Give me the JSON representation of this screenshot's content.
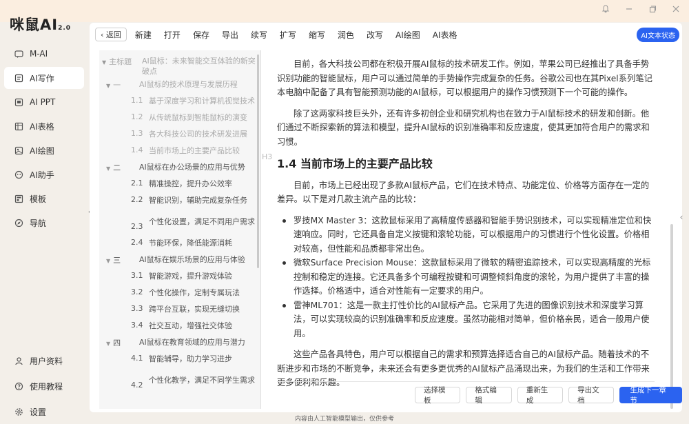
{
  "app": {
    "logo": "咪鼠AI",
    "version": "2.0"
  },
  "window_controls": [
    "bell-icon",
    "minimize-icon",
    "maximize-icon",
    "close-icon"
  ],
  "sidebar": {
    "items": [
      {
        "label": "M-AI",
        "icon": "chat-icon"
      },
      {
        "label": "AI写作",
        "icon": "write-icon",
        "active": true
      },
      {
        "label": "AI PPT",
        "icon": "ppt-icon"
      },
      {
        "label": "AI表格",
        "icon": "table-icon"
      },
      {
        "label": "AI绘图",
        "icon": "image-icon"
      },
      {
        "label": "AI助手",
        "icon": "assistant-icon"
      },
      {
        "label": "模板",
        "icon": "template-icon"
      },
      {
        "label": "导航",
        "icon": "compass-icon"
      }
    ],
    "bottom_items": [
      {
        "label": "用户资料",
        "icon": "user-icon"
      },
      {
        "label": "使用教程",
        "icon": "help-icon"
      },
      {
        "label": "设置",
        "icon": "gear-icon"
      }
    ]
  },
  "toolbar": {
    "back": "返回",
    "items": [
      "新建",
      "打开",
      "保存",
      "导出",
      "续写",
      "扩写",
      "缩写",
      "润色",
      "改写",
      "AI绘图",
      "AI表格"
    ],
    "status_badge": "AI文本状态"
  },
  "outline": {
    "root": {
      "num": "主标题",
      "text": "AI鼠标：未来智能交互体验的新突破点"
    },
    "sections": [
      {
        "num": "一",
        "text": "AI鼠标的技术原理与发展历程",
        "dim": true,
        "children": [
          {
            "num": "1.1",
            "text": "基于深度学习和计算机视觉技术"
          },
          {
            "num": "1.2",
            "text": "从传统鼠标到智能鼠标的演变"
          },
          {
            "num": "1.3",
            "text": "各大科技公司的技术研发进展"
          },
          {
            "num": "1.4",
            "text": "当前市场上的主要产品比较"
          }
        ]
      },
      {
        "num": "二",
        "text": "AI鼠标在办公场景的应用与优势",
        "children": [
          {
            "num": "2.1",
            "text": "精准操控，提升办公效率"
          },
          {
            "num": "2.2",
            "text": "智能识别，辅助完成复杂任务"
          },
          {
            "num": "2.3",
            "text": "个性化设置，满足不同用户需求"
          },
          {
            "num": "2.4",
            "text": "节能环保，降低能源消耗"
          }
        ]
      },
      {
        "num": "三",
        "text": "AI鼠标在娱乐场景的应用与体验",
        "children": [
          {
            "num": "3.1",
            "text": "智能游戏，提升游戏体验"
          },
          {
            "num": "3.2",
            "text": "个性化操作，定制专属玩法"
          },
          {
            "num": "3.3",
            "text": "跨平台互联，实现无缝切换"
          },
          {
            "num": "3.4",
            "text": "社交互动，增强社交体验"
          }
        ]
      },
      {
        "num": "四",
        "text": "AI鼠标在教育领域的应用与潜力",
        "children": [
          {
            "num": "4.1",
            "text": "智能辅导，助力学习进步"
          },
          {
            "num": "4.2",
            "text": "个性化教学，满足不同学生需求"
          }
        ]
      }
    ],
    "h3_tag": "H3"
  },
  "content": {
    "p1": "目前，各大科技公司都在积极开展AI鼠标的技术研发工作。例如，苹果公司已经推出了具备手势识别功能的智能鼠标，用户可以通过简单的手势操作完成复杂的任务。谷歌公司也在其Pixel系列笔记本电脑中配备了具有智能预测功能的AI鼠标，可以根据用户的操作习惯预测下一个可能的操作。",
    "p2": "除了这两家科技巨头外，还有许多初创企业和研究机构也在致力于AI鼠标技术的研发和创新。他们通过不断探索新的算法和模型，提升AI鼠标的识别准确率和反应速度，使其更加符合用户的需求和习惯。",
    "heading": "1.4 当前市场上的主要产品比较",
    "p3": "目前，市场上已经出现了多款AI鼠标产品，它们在技术特点、功能定位、价格等方面存在一定的差异。以下是对几款主流产品的比较：",
    "bullets": [
      "罗技MX Master 3：这款鼠标采用了高精度传感器和智能手势识别技术，可以实现精准定位和快速响应。同时，它还具备自定义按键和滚轮功能，可以根据用户的习惯进行个性化设置。价格相对较高，但性能和品质都非常出色。",
      "微软Surface Precision Mouse：这款鼠标采用了微软的精密追踪技术，可以实现高精度的光标控制和稳定的连接。它还具备多个可编程按键和可调整倾斜角度的滚轮，为用户提供了丰富的操作选择。价格适中，适合对性能有一定要求的用户。",
      "雷神ML701：这是一款主打性价比的AI鼠标产品。它采用了先进的图像识别技术和深度学习算法，可以实现较高的识别准确率和反应速度。虽然功能相对简单，但价格亲民，适合一般用户使用。"
    ],
    "p4": "这些产品各具特色，用户可以根据自己的需求和预算选择适合自己的AI鼠标产品。随着技术的不断进步和市场的不断竞争，未来还会有更多更优秀的AI鼠标产品涌现出来，为我们的生活和工作带来更多便利和乐趣。"
  },
  "actions": {
    "select_template": "选择模板",
    "format_edit": "格式编辑",
    "regenerate": "重新生成",
    "export_doc": "导出文档",
    "next_chapter": "生成下一章节"
  },
  "footer": {
    "note": "内容由人工智能模型输出，仅供参考"
  },
  "colors": {
    "accent": "#2b63f0",
    "titlebar": "#fbeee0",
    "background": "#f3efe9"
  }
}
